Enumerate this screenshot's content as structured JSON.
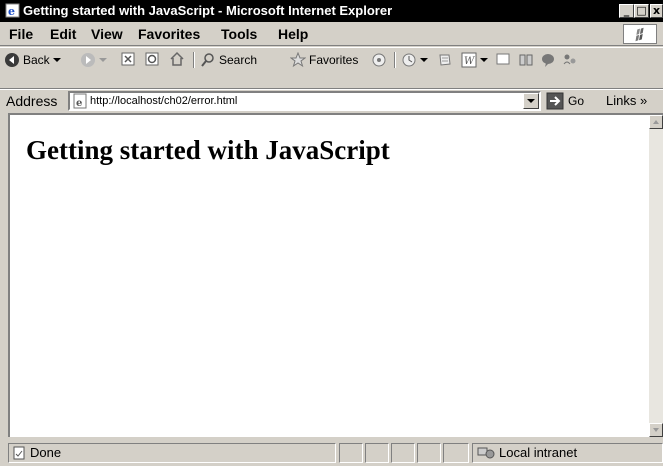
{
  "window": {
    "title": "Getting started with JavaScript - Microsoft Internet Explorer",
    "minimize_glyph": "_",
    "maximize_glyph": "□",
    "close_glyph": "x"
  },
  "menu": {
    "items": [
      "File",
      "Edit",
      "View",
      "Favorites",
      "Tools",
      "Help"
    ]
  },
  "toolbar": {
    "back_label": "Back",
    "search_label": "Search",
    "favorites_label": "Favorites"
  },
  "address": {
    "label": "Address",
    "url": "http://localhost/ch02/error.html",
    "go_label": "Go",
    "links_label": "Links",
    "links_chevron": "»"
  },
  "page": {
    "heading": "Getting started with JavaScript"
  },
  "status": {
    "text": "Done",
    "zone": "Local intranet"
  }
}
